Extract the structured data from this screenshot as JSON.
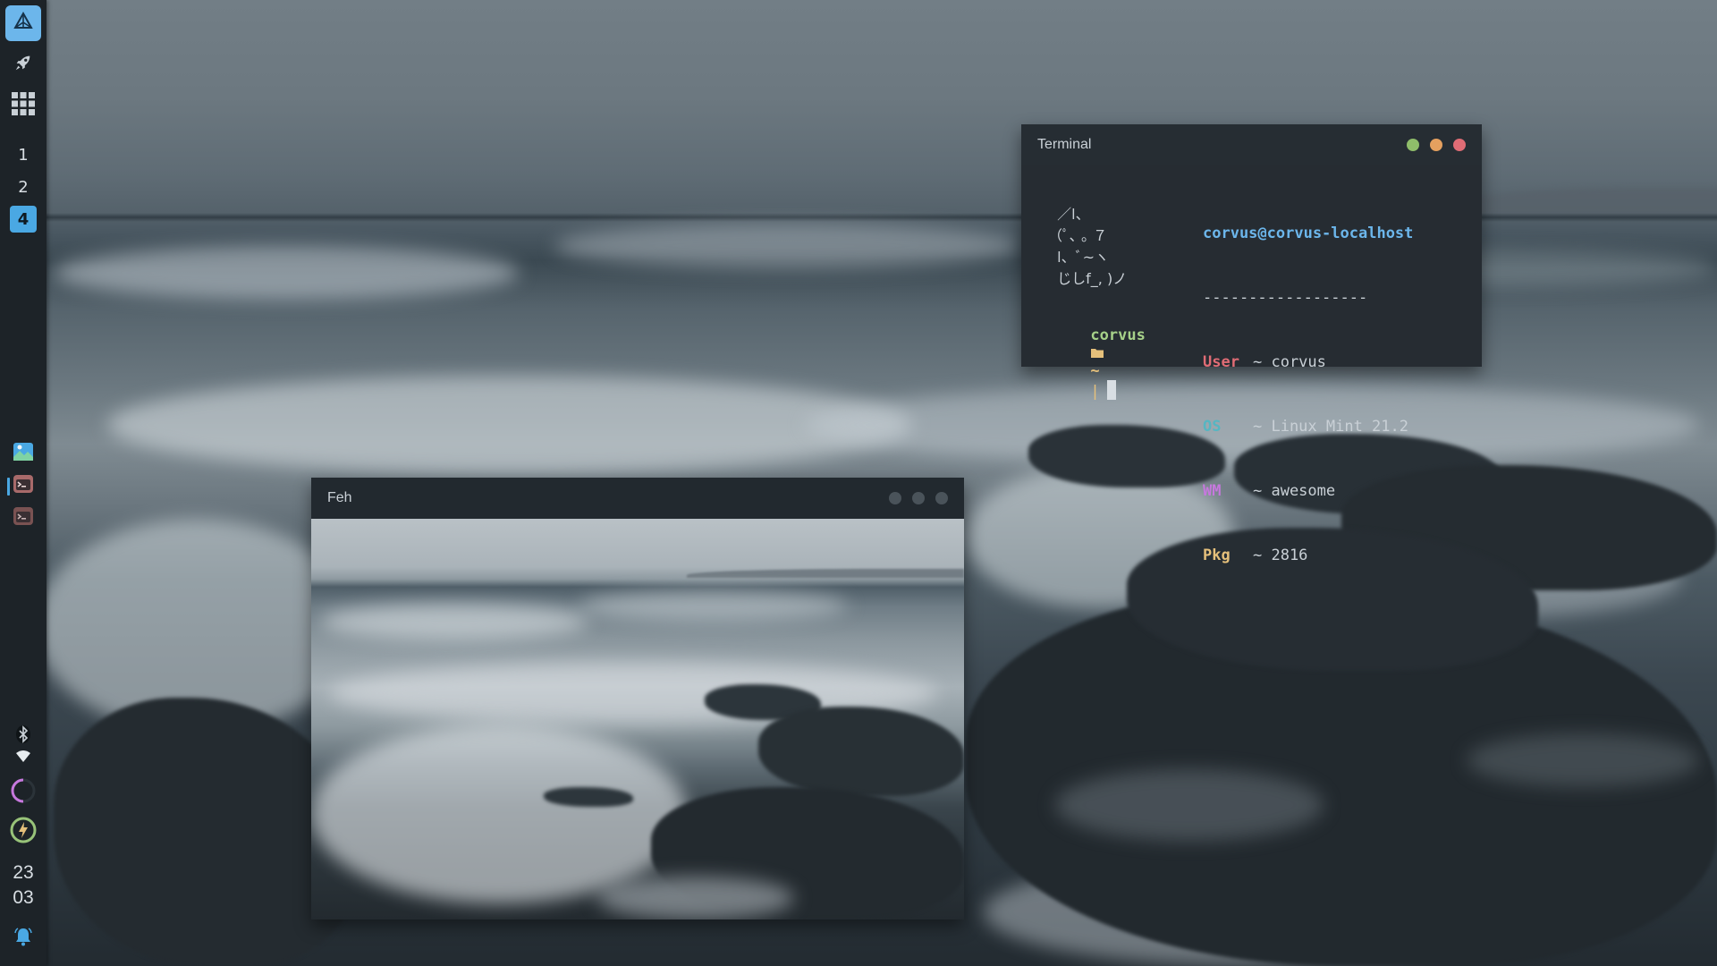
{
  "dock": {
    "launcher_icon": "prism-logo-icon",
    "rocket_icon": "rocket-icon",
    "apps_grid_icon": "grid-icon",
    "workspaces": [
      {
        "label": "1",
        "current": false
      },
      {
        "label": "2",
        "current": false
      },
      {
        "label": "4",
        "current": true
      }
    ],
    "tasks": [
      {
        "icon": "image-viewer-icon",
        "active": false
      },
      {
        "icon": "terminal-icon",
        "active": true
      },
      {
        "icon": "terminal-icon",
        "active": false
      }
    ],
    "tray": {
      "bluetooth_icon": "bluetooth-icon",
      "wifi_icon": "wifi-icon",
      "volume_icon": "volume-arc-icon",
      "battery_icon": "battery-bolt-icon"
    },
    "clock": {
      "hour": "23",
      "minute": "03"
    },
    "notification_icon": "bell-icon"
  },
  "colors": {
    "accent": "#4aa8e3",
    "dock_bg": "#1d2328",
    "close": "#e06c75",
    "minimize": "#e5a05f",
    "maximize": "#8fbd6a",
    "user_label": "#e06c75",
    "os_label": "#56b6c2",
    "wm_label": "#c678dd",
    "pkg_label": "#e5c07b"
  },
  "terminal": {
    "title": "Terminal",
    "ascii_art": [
      "  ／l、",
      "（ﾟ､ ｡ ７",
      "  l、ﾞ~ヽ",
      "  じしf_, )ノ"
    ],
    "host": "corvus@corvus-localhost",
    "separator": "------------------",
    "info": [
      {
        "key": "User",
        "value": "~ corvus"
      },
      {
        "key": "OS",
        "value": "~ Linux Mint 21.2"
      },
      {
        "key": "WM",
        "value": "~ awesome"
      },
      {
        "key": "Pkg",
        "value": "~ 2816"
      }
    ],
    "prompt": {
      "user": "corvus",
      "folder_icon": "folder-icon",
      "path": "~",
      "separator": "|"
    }
  },
  "feh": {
    "title": "Feh"
  }
}
